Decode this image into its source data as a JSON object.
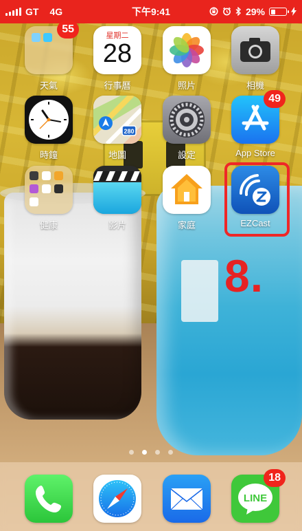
{
  "status_bar": {
    "carrier": "GT",
    "network": "4G",
    "time": "下午9:41",
    "battery_percent": "29%",
    "battery_level": 0.29,
    "background_color": "#e9241d",
    "icons": [
      "signal-bars-icon",
      "rotation-lock-icon",
      "alarm-icon",
      "bluetooth-icon",
      "battery-icon",
      "charging-bolt-icon"
    ]
  },
  "apps": {
    "weather_folder": {
      "label": "天氣",
      "badge": "55"
    },
    "calendar": {
      "label": "行事曆",
      "weekday": "星期二",
      "date": "28"
    },
    "photos": {
      "label": "照片"
    },
    "camera": {
      "label": "相機"
    },
    "clock": {
      "label": "時鐘"
    },
    "maps": {
      "label": "地圖",
      "route": "280"
    },
    "settings": {
      "label": "設定"
    },
    "app_store": {
      "label": "App Store",
      "badge": "49"
    },
    "health_folder": {
      "label": "健康"
    },
    "videos": {
      "label": "影片"
    },
    "home": {
      "label": "家庭"
    },
    "ezcast": {
      "label": "EZCast"
    }
  },
  "annotation": {
    "step_label": "8.",
    "color": "#ef2727"
  },
  "page_dots": {
    "count": 4,
    "active_index": 1
  },
  "dock": {
    "phone": {
      "label": ""
    },
    "safari": {
      "label": ""
    },
    "mail": {
      "label": ""
    },
    "line": {
      "badge": "18",
      "logo_text": "LINE"
    }
  }
}
